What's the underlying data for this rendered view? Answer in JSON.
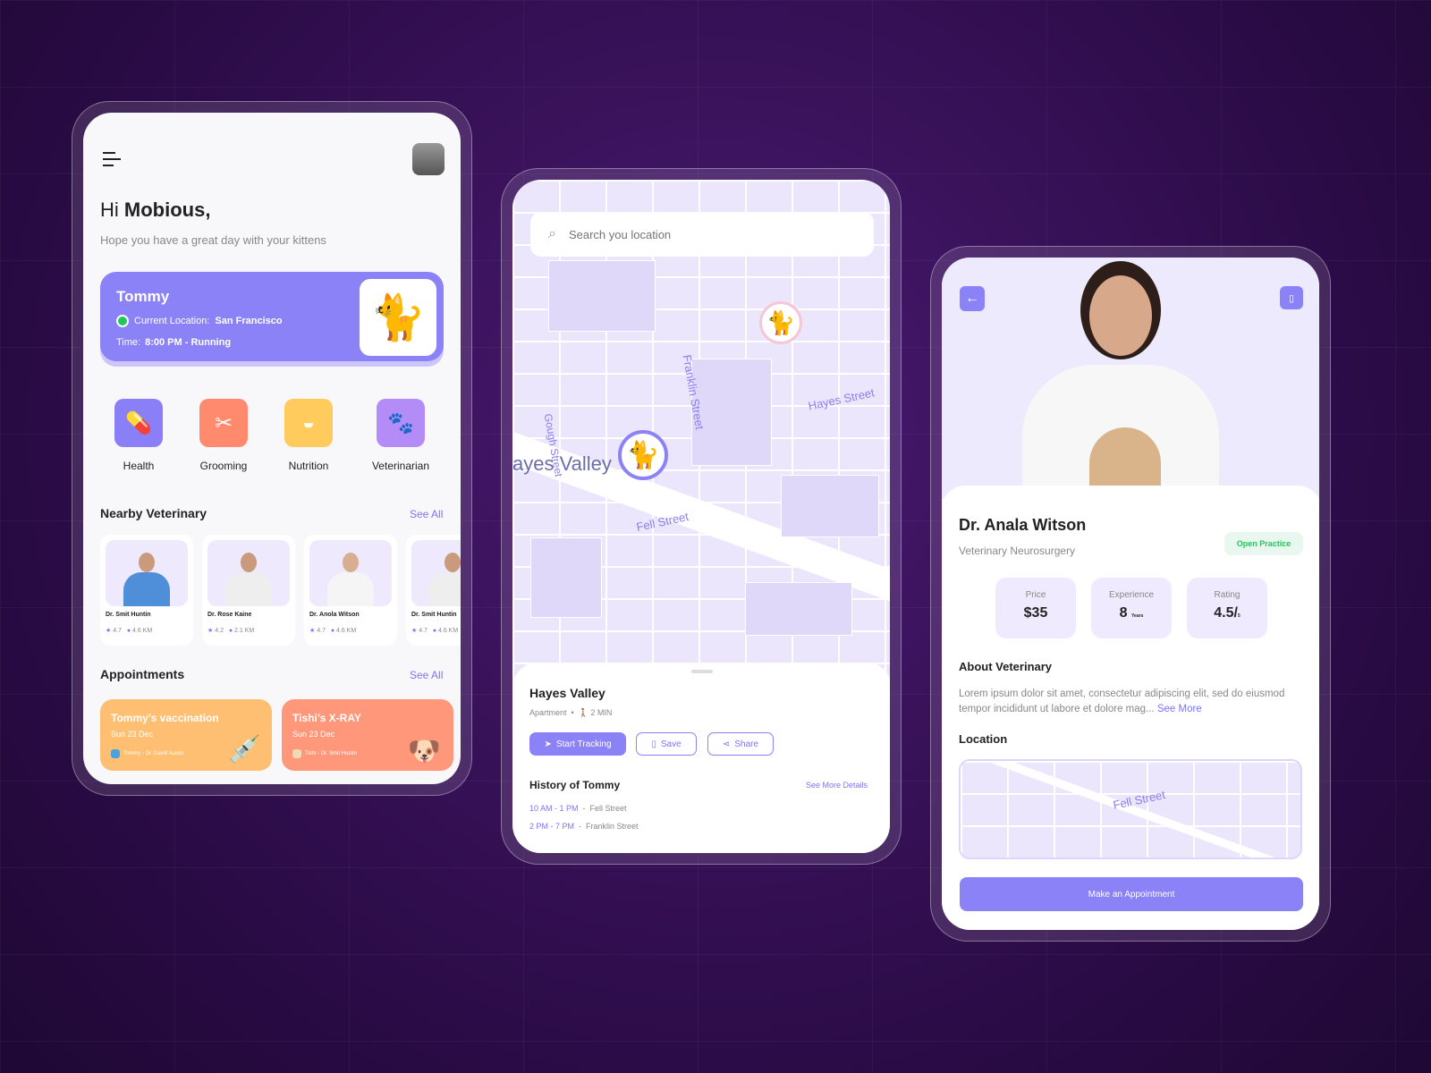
{
  "home": {
    "greeting_prefix": "Hi ",
    "user_name": "Mobious,",
    "subtitle": "Hope you have a great day with your kittens",
    "pet": {
      "name": "Tommy",
      "location_label": "Current Location:",
      "location": "San Francisco",
      "time_label": "Time:",
      "time": "8:00 PM - Running",
      "status_color": "#22c55e"
    },
    "categories": [
      {
        "label": "Health",
        "icon": "pill-icon",
        "color": "#8b7ff7"
      },
      {
        "label": "Grooming",
        "icon": "scissors-icon",
        "color": "#ff8a6e"
      },
      {
        "label": "Nutrition",
        "icon": "bowl-icon",
        "color": "#ffcb5c"
      },
      {
        "label": "Veterinarian",
        "icon": "paw-icon",
        "color": "#b48cf7"
      }
    ],
    "nearby_title": "Nearby Veterinary",
    "see_all": "See All",
    "vets": [
      {
        "name": "Dr. Smit Huntin",
        "rating": "4.7",
        "distance": "4.6 KM"
      },
      {
        "name": "Dr. Rose Kaine",
        "rating": "4.2",
        "distance": "2.1 KM"
      },
      {
        "name": "Dr. Anola Witson",
        "rating": "4.7",
        "distance": "4.6 KM"
      },
      {
        "name": "Dr. Smit Huntin",
        "rating": "4.7",
        "distance": "4.6 KM"
      }
    ],
    "appointments_title": "Appointments",
    "appointments": [
      {
        "title": "Tommy’s vaccination",
        "date": "Sun 23 Dec",
        "who": "Tommy  - Dr. David Austin",
        "color": "#ffbf73"
      },
      {
        "title": "Tishi’s X-RAY",
        "date": "Sun 23 Dec",
        "who": "Tishi  - Dr. Smit Hustin",
        "color": "#ff987a"
      }
    ]
  },
  "map": {
    "search_placeholder": "Search you location",
    "streets": {
      "franklin": "Franklin Street",
      "hayes": "Hayes Street",
      "gough": "Gough Street",
      "fell": "Fell Street",
      "area": "ayes Valley"
    },
    "place": "Hayes Valley",
    "type": "Apartment",
    "walk": "2 MIN",
    "start_tracking": "Start Tracking",
    "save": "Save",
    "share": "Share",
    "history_title": "History of Tommy",
    "see_more": "See More Details",
    "history": [
      {
        "time": "10 AM - 1 PM",
        "place": "Fell Street"
      },
      {
        "time": "2 PM - 7 PM",
        "place": "Franklin Street"
      }
    ]
  },
  "detail": {
    "name": "Dr. Anala Witson",
    "specialty": "Veterinary Neurosurgery",
    "badge": "Open Practice",
    "stats": [
      {
        "label": "Price",
        "value": "$35",
        "unit": ""
      },
      {
        "label": "Experience",
        "value": "8",
        "unit": "Years"
      },
      {
        "label": "Rating",
        "value": "4.5/",
        "unit": "5"
      }
    ],
    "about_title": "About Veterinary",
    "about": "Lorem ipsum dolor sit amet, consectetur adipiscing elit, sed do eiusmod tempor incididunt ut labore et dolore mag...",
    "see_more": "See More",
    "location_title": "Location",
    "street": "Fell Street",
    "cta": "Make an Appointment"
  },
  "accent": "#7d74f5"
}
